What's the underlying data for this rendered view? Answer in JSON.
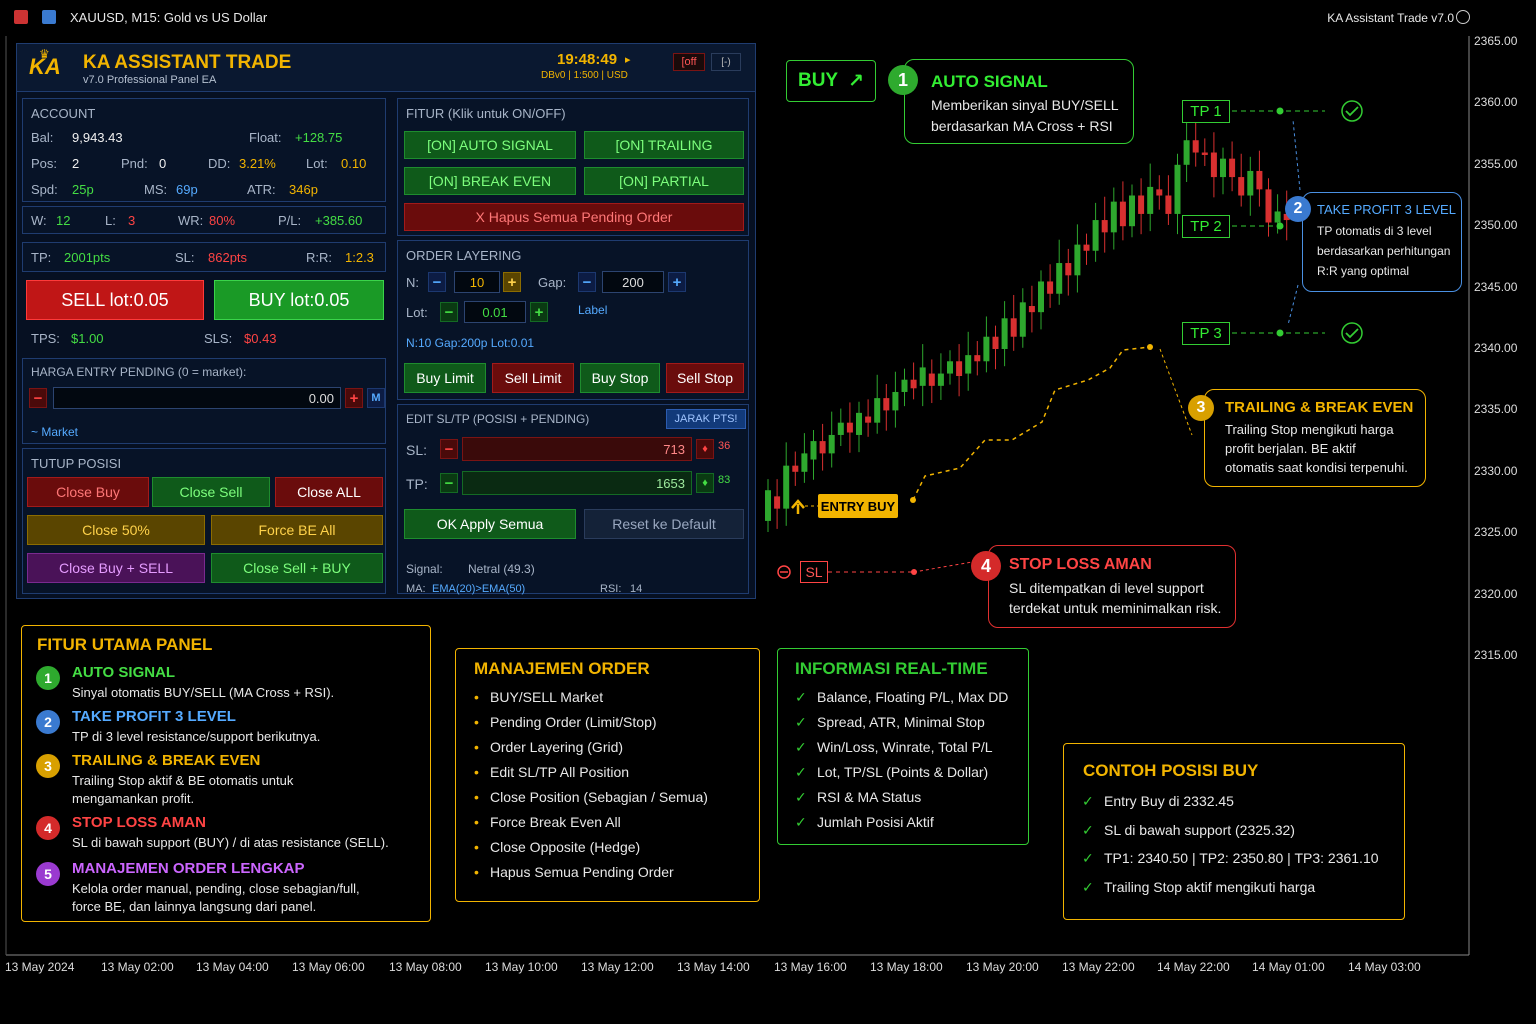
{
  "window": {
    "title": "XAUUSD, M15:  Gold vs US Dollar",
    "ea_name": "KA Assistant Trade v7.0"
  },
  "price_axis": [
    "2365.00",
    "2360.00",
    "2355.00",
    "2350.00",
    "2345.00",
    "2340.00",
    "2335.00",
    "2330.00",
    "2325.00",
    "2320.00",
    "2315.00"
  ],
  "time_axis": [
    "13 May 2024",
    "13 May 02:00",
    "13 May 04:00",
    "13 May 06:00",
    "13 May 08:00",
    "13 May 10:00",
    "13 May 12:00",
    "13 May 14:00",
    "13 May 16:00",
    "13 May 18:00",
    "13 May 20:00",
    "13 May 22:00",
    "14 May 22:00",
    "14 May 01:00",
    "14 May 03:00"
  ],
  "panel": {
    "logo": "KA",
    "title": "KA ASSISTANT TRADE",
    "subtitle": "v7.0 Professional Panel EA",
    "clock": "19:48:49",
    "clock_arrow": "▸",
    "server": "DBv0 | 1:500 | USD",
    "off_btn": "[off",
    "min_btn": "[-)",
    "account": {
      "header": "ACCOUNT",
      "bal_label": "Bal:",
      "bal": "9,943.43",
      "float_label": "Float:",
      "float": "+128.75",
      "pos_label": "Pos:",
      "pos": "2",
      "pnd_label": "Pnd:",
      "pnd": "0",
      "dd_label": "DD:",
      "dd": "3.21%",
      "lot_label": "Lot:",
      "lot": "0.10",
      "spd_label": "Spd:",
      "spd": "25p",
      "ms_label": "MS:",
      "ms": "69p",
      "atr_label": "ATR:",
      "atr": "346p"
    },
    "stats": {
      "w_label": "W:",
      "w": "12",
      "l_label": "L:",
      "l": "3",
      "wr_label": "WR:",
      "wr": "80%",
      "pl_label": "P/L:",
      "pl": "+385.60"
    },
    "tpsl": {
      "tp_label": "TP:",
      "tp": "2001pts",
      "sl_label": "SL:",
      "sl": "862pts",
      "rr_label": "R:R:",
      "rr": "1:2.3"
    },
    "sell_btn": "SELL   lot:0.05",
    "buy_btn": "BUY   lot:0.05",
    "tps_label": "TPS:",
    "tps": "$1.00",
    "sls_label": "SLS:",
    "sls": "$0.43",
    "pending": {
      "header": "HARGA ENTRY PENDING  (0 = market):",
      "minus": "−",
      "value": "0.00",
      "plus": "+",
      "m": "M",
      "market": "~ Market"
    },
    "close": {
      "header": "TUTUP POSISI",
      "close_buy": "Close Buy",
      "close_sell": "Close Sell",
      "close_all": "Close ALL",
      "close_50": "Close 50%",
      "force_be": "Force BE All",
      "close_buy_sell": "Close Buy + SELL",
      "close_sell_buy": "Close Sell + BUY"
    },
    "fitur": {
      "header": "FITUR  (Klik untuk ON/OFF)",
      "auto_signal": "[ON]  AUTO SIGNAL",
      "trailing": "[ON]  TRAILING",
      "break_even": "[ON]  BREAK EVEN",
      "partial": "[ON]  PARTIAL",
      "hapus": "X  Hapus Semua Pending Order"
    },
    "layering": {
      "header": "ORDER LAYERING",
      "n_label": "N:",
      "n": "10",
      "gap_label": "Gap:",
      "gap": "200",
      "lot_label": "Lot:",
      "lot": "0.01",
      "label": "Label",
      "minus": "−",
      "plus": "+",
      "summary": "N:10  Gap:200p  Lot:0.01",
      "buy_limit": "Buy Limit",
      "sell_limit": "Sell Limit",
      "buy_stop": "Buy Stop",
      "sell_stop": "Sell Stop"
    },
    "edit": {
      "header": "EDIT SL/TP  (POSISI + PENDING)",
      "jarak": "JARAK PTS!",
      "sl_label": "SL:",
      "sl": "713",
      "sl_side": "36",
      "tp_label": "TP:",
      "tp": "1653",
      "tp_side": "83",
      "minus": "−",
      "ok": "OK  Apply Semua",
      "reset": "Reset ke Default",
      "signal_label": "Signal:",
      "signal": "Netral (49.3)",
      "ma_label": "MA:",
      "ma": "EMA(20)>EMA(50)",
      "rsi_label": "RSI:",
      "rsi": "14"
    }
  },
  "chart_labels": {
    "buy_badge": "BUY",
    "tp1": "TP 1",
    "tp2": "TP 2",
    "tp3": "TP 3",
    "entry_buy": "ENTRY BUY",
    "sl": "SL"
  },
  "callouts": {
    "c1": {
      "num": "1",
      "title": "AUTO SIGNAL",
      "line1": "Memberikan sinyal BUY/SELL",
      "line2": "berdasarkan MA Cross + RSI"
    },
    "c2": {
      "num": "2",
      "title": "TAKE PROFIT 3 LEVEL",
      "line1": "TP otomatis di 3 level",
      "line2": "berdasarkan perhitungan",
      "line3": "R:R yang optimal"
    },
    "c3": {
      "num": "3",
      "title": "TRAILING & BREAK EVEN",
      "line1": "Trailing Stop mengikuti harga",
      "line2": "profit berjalan. BE aktif",
      "line3": "otomatis saat kondisi terpenuhi."
    },
    "c4": {
      "num": "4",
      "title": "STOP LOSS AMAN",
      "line1": "SL ditempatkan di level support",
      "line2": "terdekat untuk meminimalkan risk."
    }
  },
  "fitur_utama": {
    "header": "FITUR UTAMA PANEL",
    "items": [
      {
        "num": "1",
        "title": "AUTO SIGNAL",
        "desc": "Sinyal otomatis BUY/SELL (MA Cross + RSI).",
        "desc2": ""
      },
      {
        "num": "2",
        "title": "TAKE PROFIT 3 LEVEL",
        "desc": "TP di 3 level resistance/support berikutnya.",
        "desc2": ""
      },
      {
        "num": "3",
        "title": "TRAILING & BREAK EVEN",
        "desc": "Trailing Stop aktif & BE otomatis untuk",
        "desc2": "mengamankan profit."
      },
      {
        "num": "4",
        "title": "STOP LOSS AMAN",
        "desc": "SL di bawah support (BUY) / di atas resistance (SELL).",
        "desc2": ""
      },
      {
        "num": "5",
        "title": "MANAJEMEN ORDER LENGKAP",
        "desc": "Kelola order manual, pending, close sebagian/full,",
        "desc2": "force BE, dan lainnya langsung dari panel."
      }
    ]
  },
  "manajemen": {
    "header": "MANAJEMEN ORDER",
    "items": [
      "BUY/SELL Market",
      "Pending Order (Limit/Stop)",
      "Order Layering (Grid)",
      "Edit SL/TP All Position",
      "Close Position (Sebagian / Semua)",
      "Force Break Even All",
      "Close Opposite (Hedge)",
      "Hapus Semua Pending Order"
    ]
  },
  "informasi": {
    "header": "INFORMASI REAL-TIME",
    "items": [
      "Balance, Floating P/L, Max DD",
      "Spread, ATR, Minimal Stop",
      "Win/Loss, Winrate, Total P/L",
      "Lot, TP/SL (Points & Dollar)",
      "RSI & MA Status",
      "Jumlah Posisi Aktif"
    ]
  },
  "contoh": {
    "header": "CONTOH POSISI BUY",
    "items": [
      "Entry Buy di 2332.45",
      "SL di bawah support (2325.32)",
      "TP1: 2340.50 | TP2: 2350.80 | TP3: 2361.10",
      "Trailing Stop aktif mengikuti harga"
    ]
  },
  "colors": {
    "green": "#44dd44",
    "yellow": "#f2b400",
    "red": "#ff4444",
    "blue": "#55aaff",
    "purple": "#cc55ff",
    "panel_bg": "#061022",
    "panel_border": "#1f3c70"
  }
}
